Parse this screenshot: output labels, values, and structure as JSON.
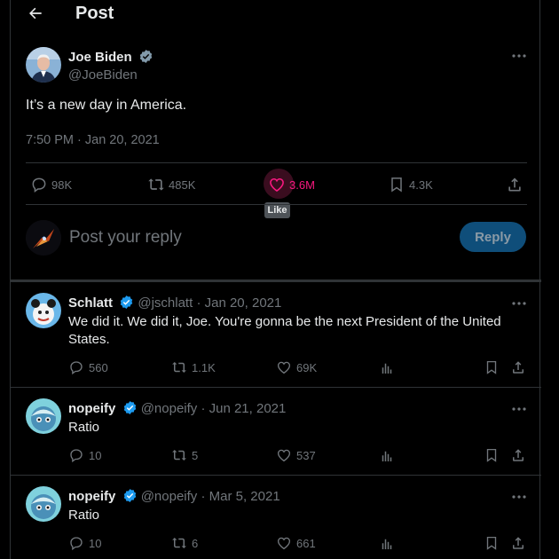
{
  "header": {
    "title": "Post"
  },
  "post": {
    "author_name": "Joe Biden",
    "author_handle": "@JoeBiden",
    "text": "It’s a new day in America.",
    "timestamp": "7:50 PM · Jan 20, 2021",
    "stats": {
      "replies": "98K",
      "reposts": "485K",
      "likes": "3.6M",
      "bookmarks": "4.3K"
    },
    "tooltip": "Like"
  },
  "composer": {
    "placeholder": "Post your reply",
    "button_label": "Reply"
  },
  "replies": [
    {
      "name": "Schlatt",
      "meta": "@jschlatt · Jan 20, 2021",
      "text": "We did it. We did it, Joe. You're gonna be the next President of the United States.",
      "replies": "560",
      "reposts": "1.1K",
      "likes": "69K"
    },
    {
      "name": "nopeify",
      "meta": "@nopeify · Jun 21, 2021",
      "text": "Ratio",
      "replies": "10",
      "reposts": "5",
      "likes": "537"
    },
    {
      "name": "nopeify",
      "meta": "@nopeify · Mar 5, 2021",
      "text": "Ratio",
      "replies": "10",
      "reposts": "6",
      "likes": "661"
    }
  ],
  "colors": {
    "background": "#000000",
    "text": "#e7e9ea",
    "muted": "#71767b",
    "accent": "#1d9bf0",
    "like": "#f91880"
  }
}
